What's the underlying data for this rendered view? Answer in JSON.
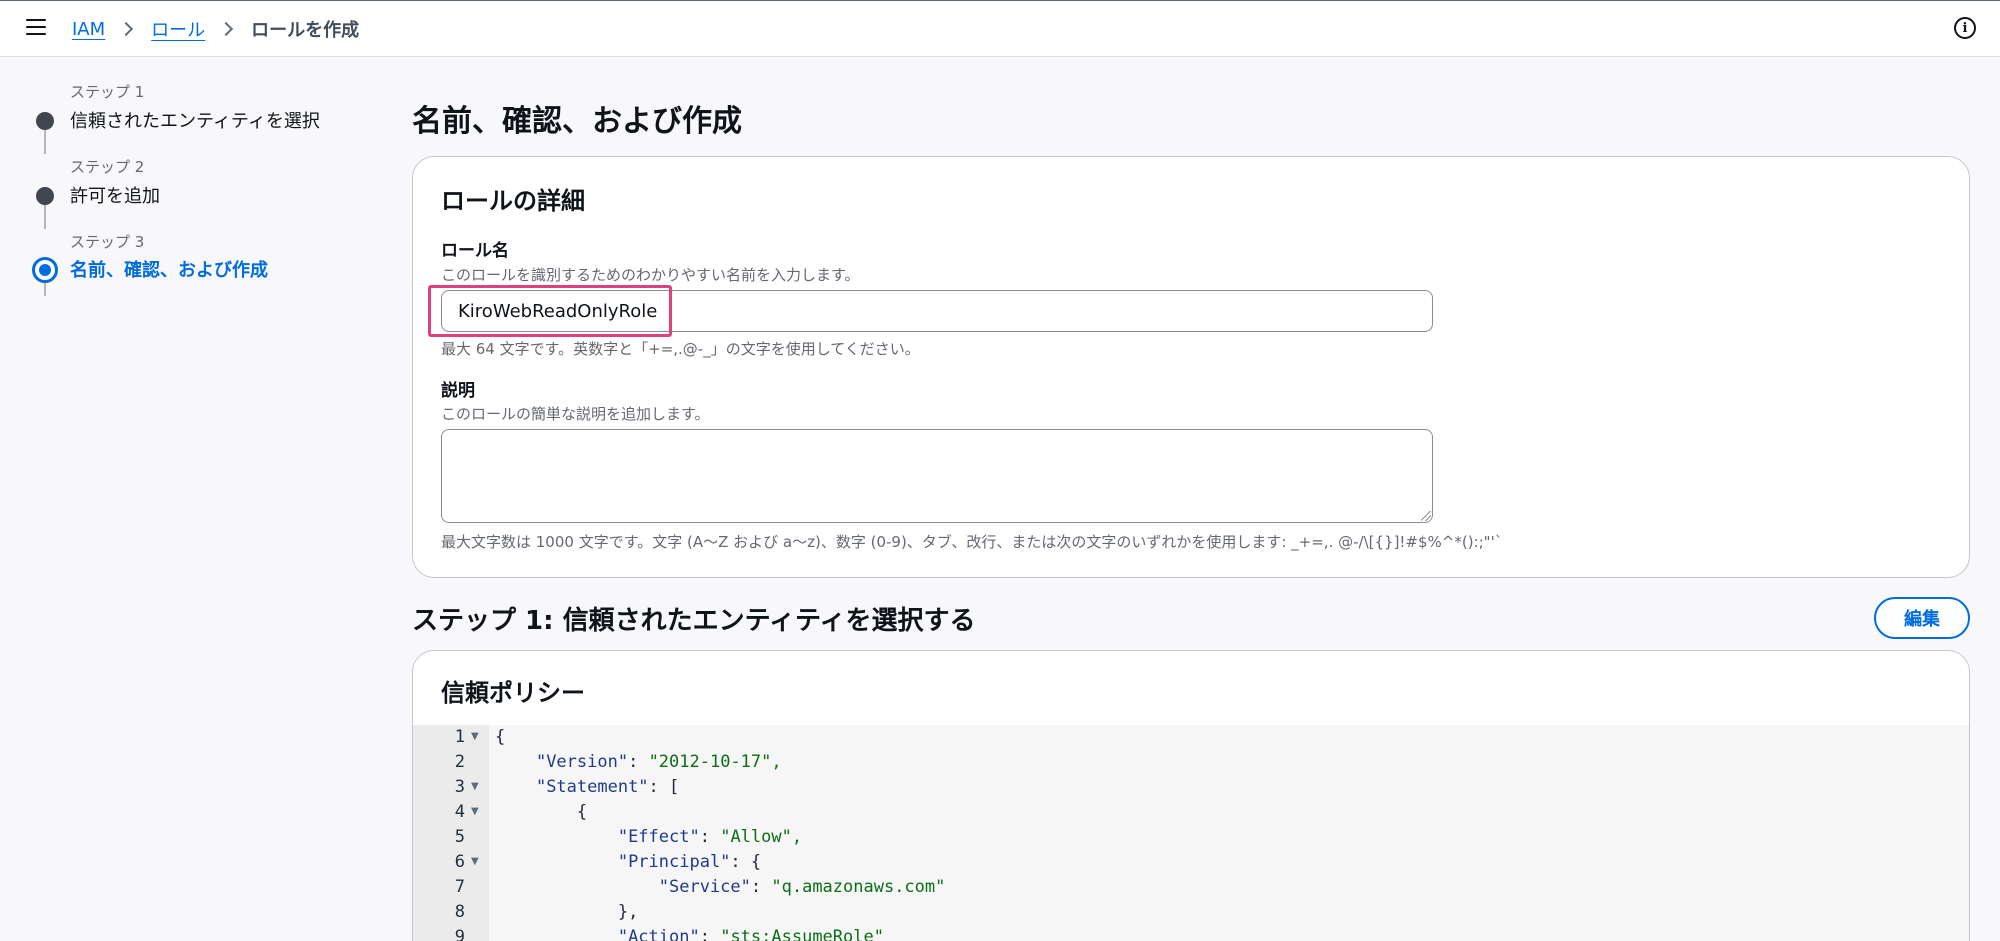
{
  "topbar": {
    "breadcrumbs": [
      "IAM",
      "ロール"
    ],
    "current": "ロールを作成"
  },
  "steps": [
    {
      "num": "ステップ 1",
      "label": "信頼されたエンティティを選択"
    },
    {
      "num": "ステップ 2",
      "label": "許可を追加"
    },
    {
      "num": "ステップ 3",
      "label": "名前、確認、および作成"
    }
  ],
  "page_title": "名前、確認、および作成",
  "role_details": {
    "title": "ロールの詳細",
    "name_label": "ロール名",
    "name_desc": "このロールを識別するためのわかりやすい名前を入力します。",
    "name_value": "KiroWebReadOnlyRole",
    "name_hint": "最大 64 文字です。英数字と「+=,.@-_」の文字を使用してください。",
    "desc_label": "説明",
    "desc_desc": "このロールの簡単な説明を追加します。",
    "desc_value": "",
    "desc_hint": "最大文字数は 1000 文字です。文字 (A〜Z および a〜z)、数字 (0-9)、タブ、改行、または次の文字のいずれかを使用します: _+=,. @-/\\[{}]!#$%^*():;\"'`"
  },
  "step1_section": {
    "title": "ステップ 1: 信頼されたエンティティを選択する",
    "edit_label": "編集"
  },
  "trust_policy": {
    "title": "信頼ポリシー",
    "line_numbers": [
      "1",
      "2",
      "3",
      "4",
      "5",
      "6",
      "7",
      "8",
      "9"
    ],
    "lines": [
      {
        "indent": "",
        "key": "",
        "sep": "{",
        "value": ""
      },
      {
        "indent": "    ",
        "key": "\"Version\"",
        "sep": ": ",
        "value": "\"2012-10-17\","
      },
      {
        "indent": "    ",
        "key": "\"Statement\"",
        "sep": ": [",
        "value": ""
      },
      {
        "indent": "        ",
        "key": "",
        "sep": "{",
        "value": ""
      },
      {
        "indent": "            ",
        "key": "\"Effect\"",
        "sep": ": ",
        "value": "\"Allow\","
      },
      {
        "indent": "            ",
        "key": "\"Principal\"",
        "sep": ": {",
        "value": ""
      },
      {
        "indent": "                ",
        "key": "\"Service\"",
        "sep": ": ",
        "value": "\"q.amazonaws.com\""
      },
      {
        "indent": "            ",
        "key": "",
        "sep": "},",
        "value": ""
      },
      {
        "indent": "            ",
        "key": "\"Action\"",
        "sep": ": ",
        "value": "\"sts:AssumeRole\""
      }
    ]
  },
  "colors": {
    "accent": "#006ce0",
    "highlight": "#e0407b",
    "step_done": "#424650"
  }
}
